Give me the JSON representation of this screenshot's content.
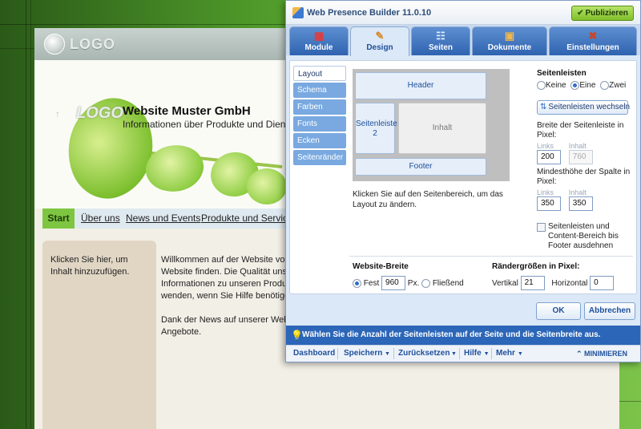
{
  "website": {
    "logo_text": "LOGO",
    "header_logo_text": "LOGO",
    "company_name": "Website Muster GmbH",
    "tagline": "Informationen über Produkte und Dien",
    "nav": [
      "Start",
      "Über uns",
      "News und Events",
      "Produkte und Services"
    ],
    "sidebar_text": "Klicken Sie hier, um Inhalt hinzuzufügen.",
    "content_text": "Willkommen auf der Website von\nWebsite finden. Die Qualität unser\nInformationen zu unseren Produk\nwenden, wenn Sie Hilfe benötigen\n\nDank der News auf unserer Webs\nAngebote."
  },
  "dialog": {
    "app_title": "Web Presence Builder 11.0.10",
    "publish_label": "Publizieren",
    "tabs": [
      {
        "label": "Module",
        "icon": "module-icon"
      },
      {
        "label": "Design",
        "icon": "design-icon"
      },
      {
        "label": "Seiten",
        "icon": "pages-icon"
      },
      {
        "label": "Dokumente",
        "icon": "documents-icon"
      },
      {
        "label": "Einstellungen",
        "icon": "settings-icon"
      }
    ],
    "active_tab": "Design",
    "subnav": [
      "Layout",
      "Schema",
      "Farben",
      "Fonts",
      "Ecken",
      "Seitenränder"
    ],
    "active_subnav": "Layout",
    "layout_preview": {
      "header": "Header",
      "sidebar": "Seitenleiste 2",
      "content": "Inhalt",
      "footer": "Footer"
    },
    "layout_hint": "Klicken Sie auf den Seitenbereich, um das Layout zu ändern.",
    "sidebars": {
      "title": "Seitenleisten",
      "options": [
        "Keine",
        "Eine",
        "Zwei"
      ],
      "selected": "Eine",
      "switch_label": "Seitenleisten wechseln",
      "width_label": "Breite der Seitenleiste in Pixel:",
      "links_label": "Links",
      "inhalt_label": "Inhalt",
      "width_links": "200",
      "width_inhalt": "760",
      "minheight_label": "Mindesthöhe der Spalte in Pixel:",
      "minheight_links": "350",
      "minheight_inhalt": "350",
      "extend_label": "Seitenleisten und Content-Bereich bis Footer ausdehnen",
      "extend_checked": false
    },
    "website_width": {
      "title": "Website-Breite",
      "fixed_label": "Fest",
      "fixed_value": "960",
      "unit": "Px.",
      "fluid_label": "Fließend",
      "selected": "Fest"
    },
    "margins": {
      "title": "Rändergrößen in Pixel:",
      "vertical_label": "Vertikal",
      "vertical_value": "21",
      "horizontal_label": "Horizontal",
      "horizontal_value": "0"
    },
    "ok_label": "OK",
    "cancel_label": "Abbrechen",
    "hint": "Wählen Sie die Anzahl der Seitenleisten auf der Seite und die Seitenbreite aus.",
    "bottom_bar": [
      "Dashboard",
      "Speichern",
      "Zurücksetzen",
      "Hilfe",
      "Mehr"
    ],
    "minimize_label": "MINIMIEREN"
  },
  "colors": {
    "accent_blue": "#2c66b8",
    "publish_green": "#7fbf2a",
    "nav_active": "#7ec641"
  }
}
